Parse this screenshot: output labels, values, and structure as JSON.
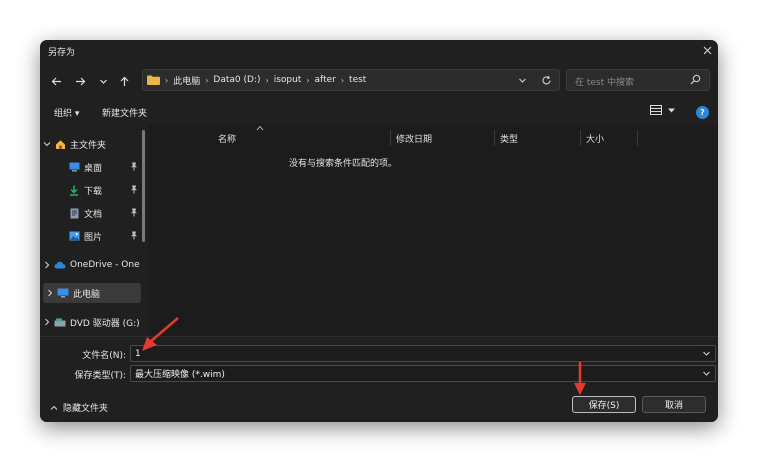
{
  "window": {
    "title": "另存为",
    "close_glyph": "✕"
  },
  "nav": {
    "back_glyph": "←",
    "forward_glyph": "→",
    "recent_glyph": "⌄",
    "up_glyph": "↑",
    "path": [
      "此电脑",
      "Data0 (D:)",
      "isoput",
      "after",
      "test"
    ],
    "path_separator": "›",
    "search_placeholder": "在 test 中搜索"
  },
  "toolbar": {
    "organize": "组织 ▾",
    "new_folder": "新建文件夹",
    "help_glyph": "?"
  },
  "sidebar": {
    "home": "主文件夹",
    "desktop": "桌面",
    "downloads": "下载",
    "documents": "文档",
    "pictures": "图片",
    "onedrive": "OneDrive - One",
    "this_pc": "此电脑",
    "dvd": "DVD 驱动器 (G:)"
  },
  "columns": {
    "name": "名称",
    "modified": "修改日期",
    "type": "类型",
    "size": "大小"
  },
  "filelist": {
    "empty_message": "没有与搜索条件匹配的项。"
  },
  "form": {
    "filename_label": "文件名(N):",
    "filename_value": "1",
    "filetype_label": "保存类型(T):",
    "filetype_value": "最大压缩映像 (*.wim)"
  },
  "footer": {
    "hide_folders": "隐藏文件夹",
    "save": "保存(S)",
    "cancel": "取消"
  },
  "colors": {
    "accent": "#2b88d8",
    "folder": "#e8b84a",
    "annotation_arrow": "#e53a2f"
  }
}
